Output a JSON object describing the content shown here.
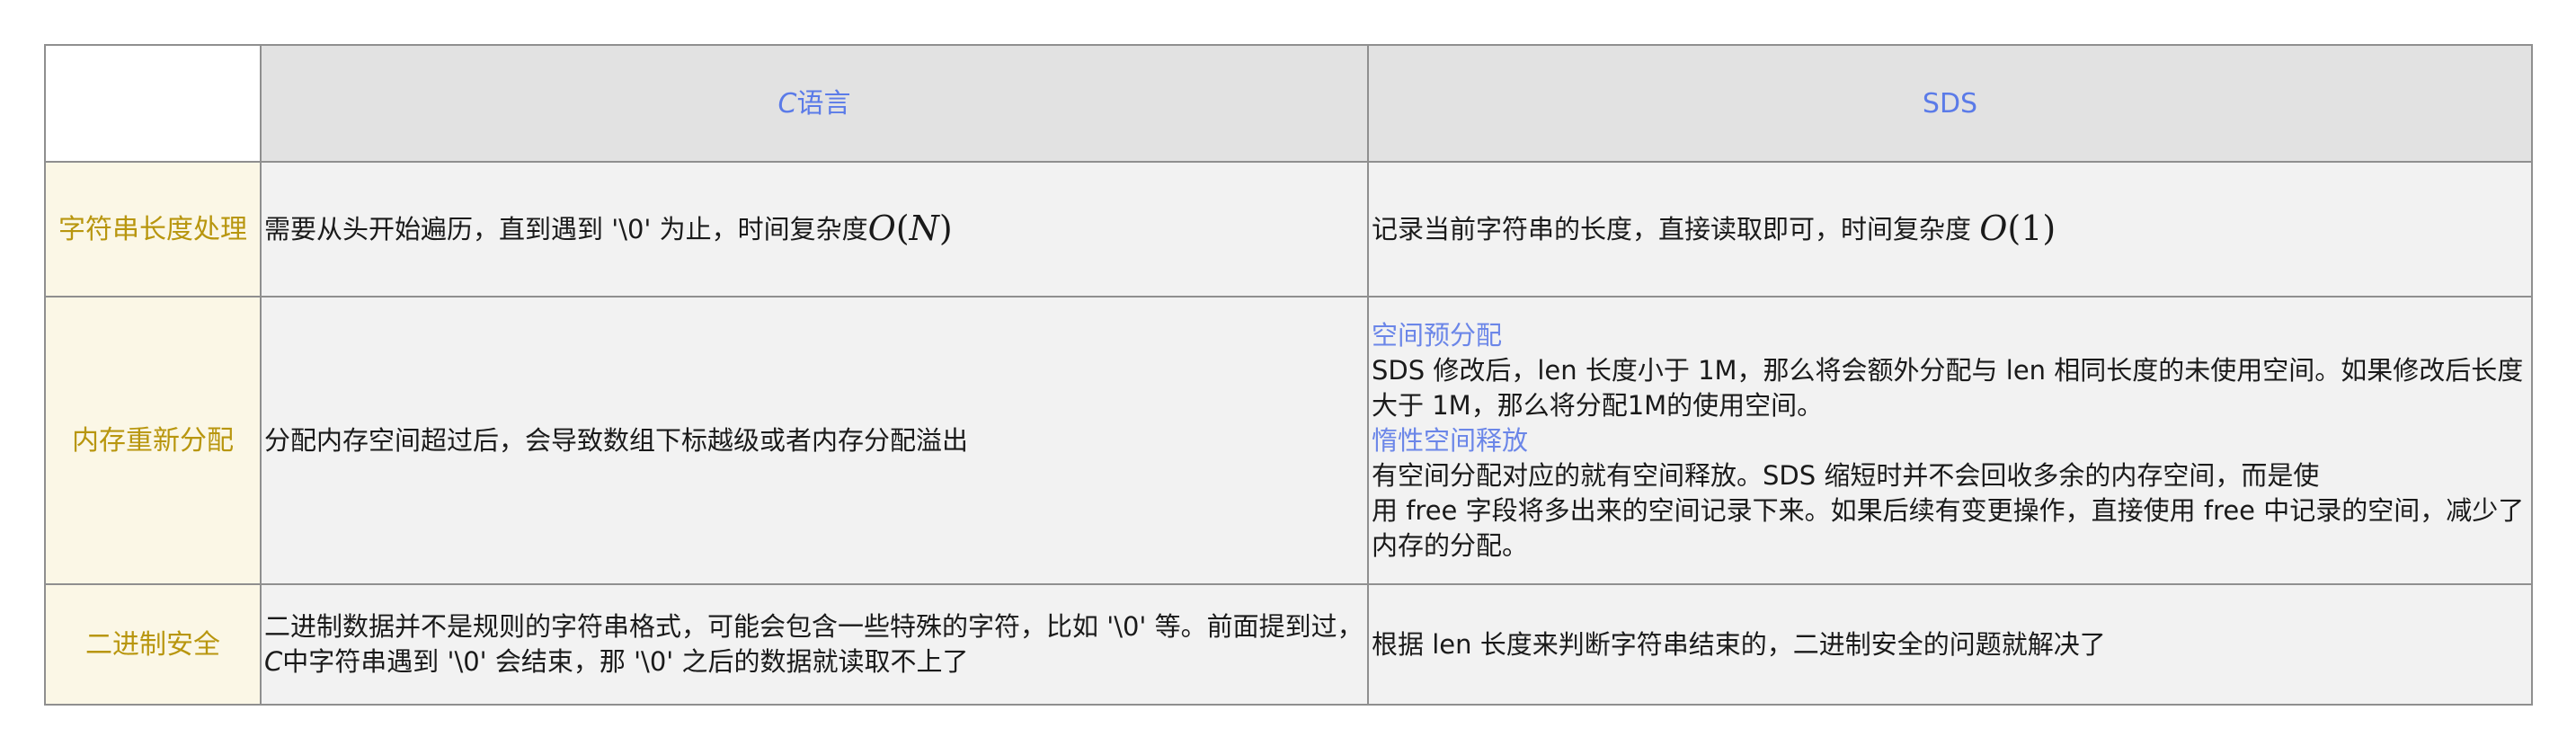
{
  "table": {
    "headers": {
      "corner": "",
      "c_prefix": "C",
      "c_suffix": "语言",
      "sds": "SDS"
    },
    "rows": {
      "length": {
        "label": "字符串长度处理",
        "c_text": "需要从头开始遍历，直到遇到 '\\0' 为止，时间复杂度",
        "c_math_symbol": "O",
        "c_math_arg": "N",
        "sds_text": "记录当前字符串的长度，直接读取即可，时间复杂度 ",
        "sds_math_symbol": "O",
        "sds_math_arg": "1"
      },
      "memory": {
        "label": "内存重新分配",
        "c_text": "分配内存空间超过后，会导致数组下标越级或者内存分配溢出",
        "sds_title_1": "空间预分配",
        "sds_text_1": "SDS 修改后，len 长度小于 1M，那么将会额外分配与 len 相同长度的未使用空间。如果修改后长度大于 1M，那么将分配1M的使用空间。",
        "sds_title_2": "惰性空间释放",
        "sds_text_2a": "有空间分配对应的就有空间释放。SDS 缩短时并不会回收多余的内存空间，而是使",
        "sds_text_2b": "用 free 字段将多出来的空间记录下来。如果后续有变更操作，直接使用 free 中记录的空间，减少了内存的分配。"
      },
      "binary": {
        "label": "二进制安全",
        "c_text_1": "二进制数据并不是规则的字符串格式，可能会包含一些特殊的字符，比如 '\\0' 等。前面提到过，",
        "c_text_c": "C",
        "c_text_2": "中字符串遇到 '\\0' 会结束，那 '\\0' 之后的数据就读取不上了",
        "sds_text": "根据 len 长度来判断字符串结束的，二进制安全的问题就解决了"
      }
    }
  },
  "colors": {
    "header_text": "#5b7be8",
    "label_text": "#b8960e",
    "label_bg": "#fbf7e6",
    "header_bg": "#e2e2e2",
    "cell_bg": "#f2f2f2",
    "sub_title": "#6b86e8"
  }
}
